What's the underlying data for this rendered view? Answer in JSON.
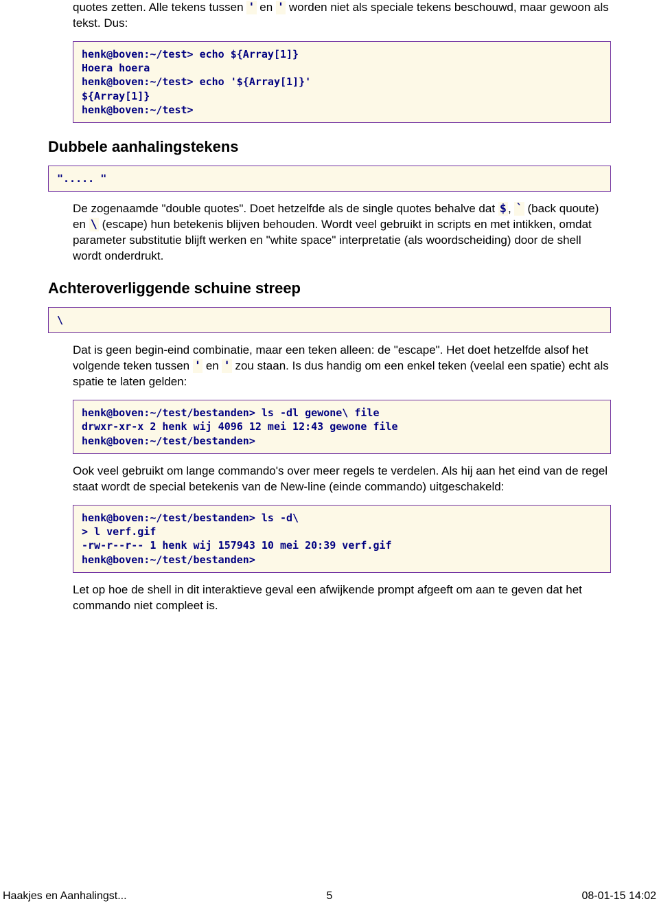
{
  "intro": {
    "p1a": "quotes zetten. Alle tekens tussen ",
    "q1": "'",
    "p1b": " en ",
    "q2": "'",
    "p1c": " worden niet als speciale tekens beschouwd, maar gewoon als tekst. Dus:"
  },
  "code1": "henk@boven:~/test> echo ${Array[1]}\nHoera hoera\nhenk@boven:~/test> echo '${Array[1]}'\n${Array[1]}\nhenk@boven:~/test>",
  "h_dubbele": "Dubbele aanhalingstekens",
  "code2": "\"..... \"",
  "dubbele": {
    "t1": "De zogenaamde \"double quotes\". Doet hetzelfde als de single quotes behalve dat ",
    "c1": "$",
    "t2": ", ",
    "c2": "`",
    "t3": " (back quoute) en ",
    "c3": "\\",
    "t4": " (escape) hun betekenis blijven behouden. Wordt veel gebruikt in scripts en met intikken, omdat parameter substitutie blijft werken en \"white space\" interpretatie (als woordscheiding) door de shell wordt onderdrukt."
  },
  "h_streep": "Achteroverliggende schuine streep",
  "code3": "\\",
  "streep": {
    "t1": "Dat is geen begin-eind combinatie, maar een teken alleen: de \"escape\". Het doet hetzelfde alsof het volgende teken tussen ",
    "c1": "'",
    "t2": " en ",
    "c2": "'",
    "t3": " zou staan. Is dus handig om een enkel teken (veelal een spatie) echt als spatie te laten gelden:"
  },
  "code4": "henk@boven:~/test/bestanden> ls -dl gewone\\ file\ndrwxr-xr-x 2 henk wij 4096 12 mei 12:43 gewone file\nhenk@boven:~/test/bestanden>",
  "p_ook": "Ook veel gebruikt om lange commando's over meer regels te verdelen. Als hij aan het eind van de regel staat wordt de special betekenis van de New-line (einde commando) uitgeschakeld:",
  "code5": "henk@boven:~/test/bestanden> ls -d\\\n> l verf.gif\n-rw-r--r-- 1 henk wij 157943 10 mei 20:39 verf.gif\nhenk@boven:~/test/bestanden>",
  "p_let": "Let op hoe de shell in dit interaktieve geval een afwijkende prompt afgeeft om aan te geven dat het commando niet compleet is.",
  "footer": {
    "left": "Haakjes en Aanhalingst...",
    "center": "5",
    "right": "08-01-15 14:02"
  }
}
